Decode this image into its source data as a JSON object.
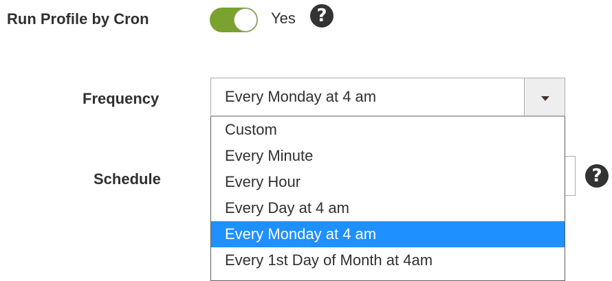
{
  "run_profile": {
    "label": "Run Profile by Cron",
    "toggle_state": "Yes",
    "help_icon": "question-circle-icon"
  },
  "frequency": {
    "label": "Frequency",
    "selected_value": "Every Monday at 4 am",
    "options": [
      "Custom",
      "Every Minute",
      "Every Hour",
      "Every Day at 4 am",
      "Every Monday at 4 am",
      "Every 1st Day of Month at 4am"
    ],
    "highlighted_index": 4
  },
  "schedule": {
    "label": "Schedule",
    "help_icon": "question-circle-icon"
  },
  "colors": {
    "toggle_on": "#79a22e",
    "highlight": "#1e90ff",
    "text": "#303030",
    "help_icon_bg": "#333333"
  }
}
